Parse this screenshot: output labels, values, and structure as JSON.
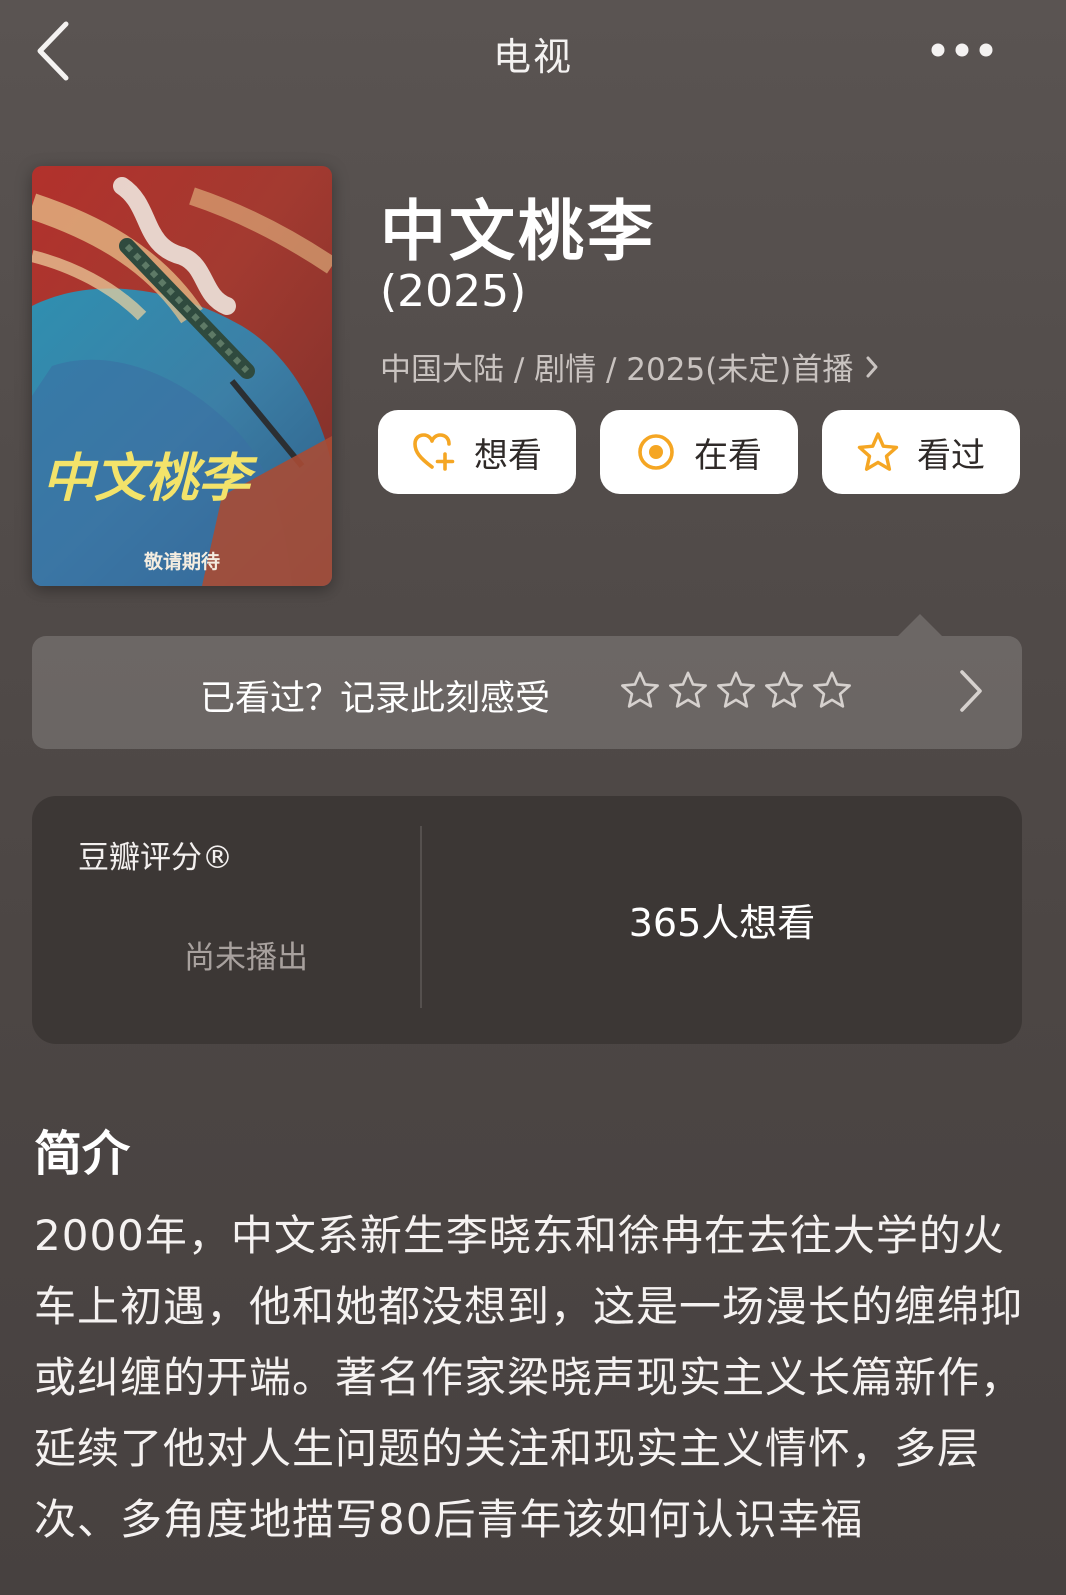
{
  "nav": {
    "title": "电视"
  },
  "poster": {
    "calligraphy": "中文桃李",
    "caption": "敬请期待"
  },
  "movie": {
    "title": "中文桃李",
    "year": "(2025)",
    "meta": "中国大陆 / 剧情 / 2025(未定)首播"
  },
  "actions": {
    "want_label": "想看",
    "doing_label": "在看",
    "done_label": "看过"
  },
  "rate_prompt": {
    "text": "已看过？记录此刻感受",
    "star_count": 5
  },
  "score": {
    "label": "豆瓣评分®",
    "status": "尚未播出",
    "want_count": "365人想看"
  },
  "intro": {
    "heading": "简介",
    "body": "2000年，中文系新生李晓东和徐冉在去往大学的火车上初遇，他和她都没想到，这是一场漫长的缠绵抑或纠缠的开端。著名作家梁晓声现实主义长篇新作，延续了他对人生问题的关注和现实主义情怀，多层次、多角度地描写80后青年该如何认识幸福"
  },
  "colors": {
    "accent": "#f5a623",
    "background": "#524c4a",
    "card": "#3c3735"
  },
  "icons": {
    "back": "chevron-left-icon",
    "more": "more-dots-icon",
    "want": "heart-plus-icon",
    "doing": "target-circle-icon",
    "done": "star-icon"
  }
}
